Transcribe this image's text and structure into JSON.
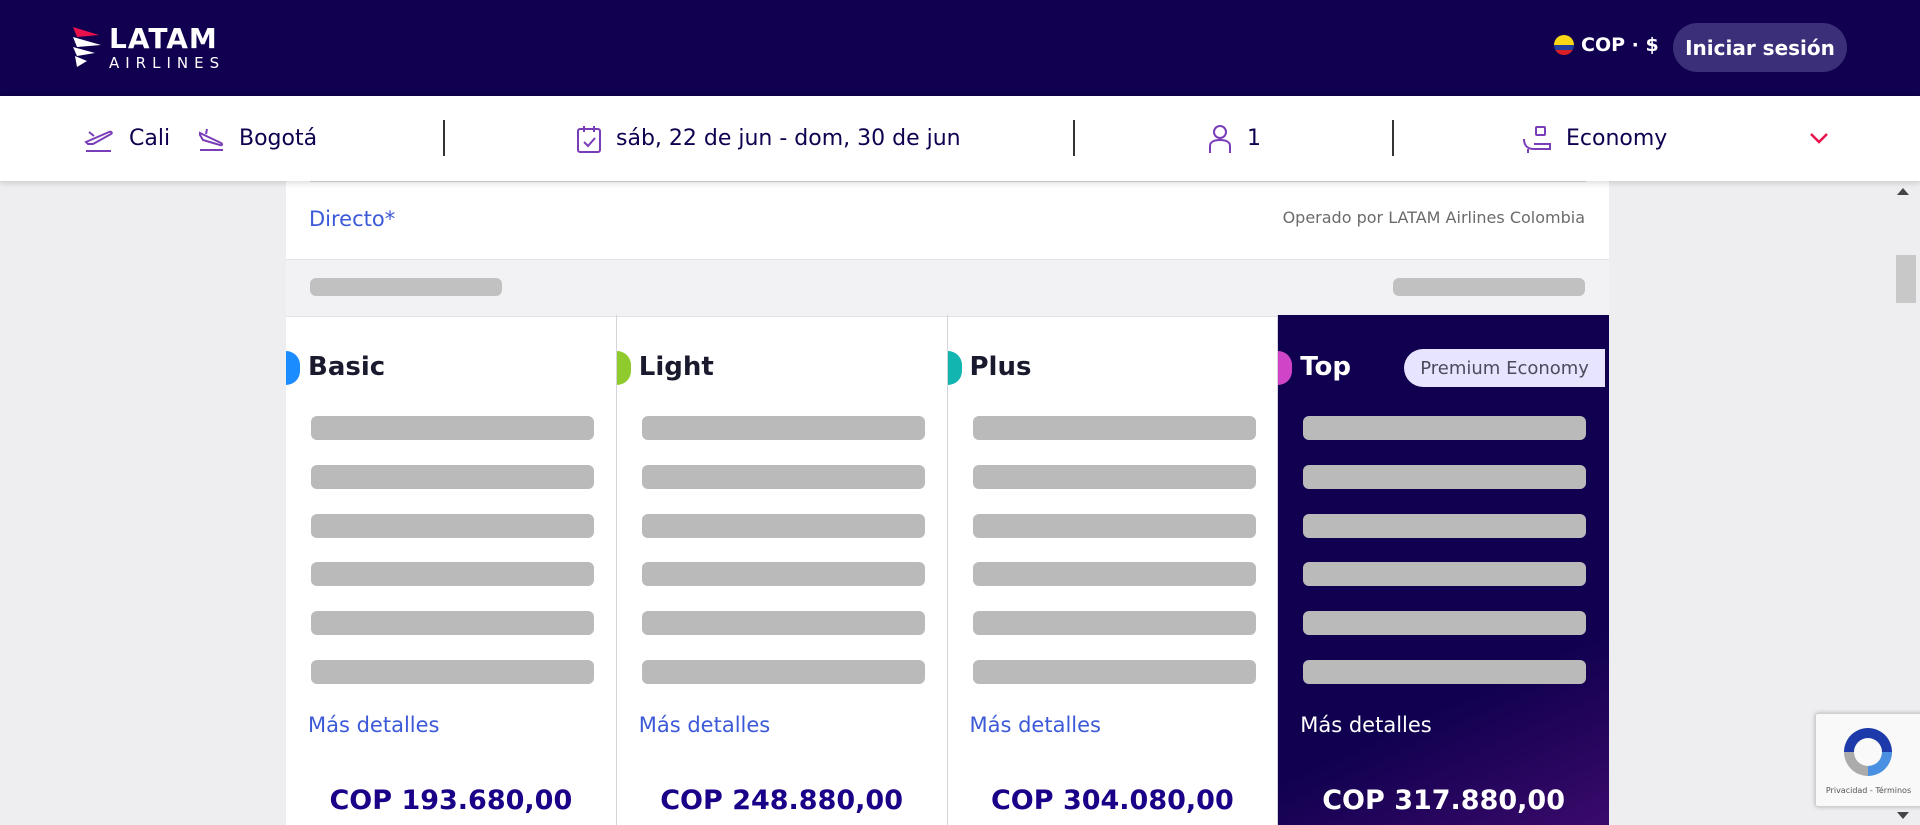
{
  "header": {
    "logo": {
      "line1": "LATAM",
      "line2": "AIRLINES"
    },
    "currency": "COP · $",
    "login_label": "Iniciar sesión"
  },
  "search": {
    "origin": "Cali",
    "destination": "Bogotá",
    "dates": "sáb, 22 de jun - dom, 30 de jun",
    "passengers": "1",
    "cabin": "Economy"
  },
  "flight": {
    "type_label": "Directo*",
    "operated_by": "Operado por LATAM Airlines Colombia"
  },
  "fares": [
    {
      "name": "Basic",
      "color": "#1a8cff",
      "details_label": "Más detalles",
      "price": "COP 193.680,00"
    },
    {
      "name": "Light",
      "color": "#8fcb2c",
      "details_label": "Más detalles",
      "price": "COP 248.880,00"
    },
    {
      "name": "Plus",
      "color": "#12b5b0",
      "details_label": "Más detalles",
      "price": "COP 304.080,00"
    },
    {
      "name": "Top",
      "color": "#d044c8",
      "badge": "Premium Economy",
      "details_label": "Más detalles",
      "price": "COP 317.880,00"
    }
  ],
  "recaptcha": {
    "terms": "Privacidad - Términos"
  },
  "colors": {
    "brand_navy": "#10004f",
    "link_blue": "#3c5ad8",
    "accent_pink": "#e8114b"
  }
}
